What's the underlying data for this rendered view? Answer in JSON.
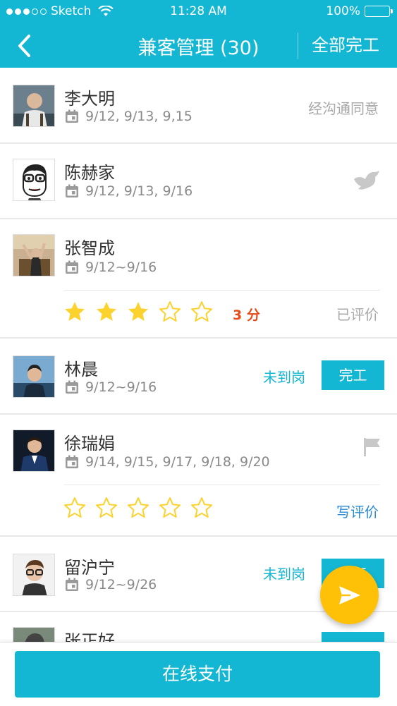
{
  "status_bar": {
    "carrier": "Sketch",
    "time": "11:28 AM",
    "battery": "100%",
    "signal_dots_filled": 3,
    "signal_dots_total": 5
  },
  "nav": {
    "back_icon": "chevron-left-icon",
    "title": "兼客管理 (30)",
    "complete_all_label": "全部完工"
  },
  "workers": [
    {
      "name": "李大明",
      "dates": "9/12, 9/13, 9,15",
      "status": "经沟通同意"
    },
    {
      "name": "陈赫家",
      "dates": "9/12, 9/13, 9/16",
      "status_icon": "bird-icon"
    },
    {
      "name": "张智成",
      "dates": "9/12~9/16",
      "rating": 3,
      "rating_max": 5,
      "score": "3 分",
      "status": "已评价"
    },
    {
      "name": "林晨",
      "dates": "9/12~9/16",
      "status": "未到岗",
      "action": "完工"
    },
    {
      "name": "徐瑞娟",
      "dates": "9/14, 9/15, 9/17, 9/18, 9/20",
      "status_icon": "flag-icon",
      "rating": 0,
      "rating_max": 5,
      "review_link": "写评价"
    },
    {
      "name": "留沪宁",
      "dates": "9/12~9/26",
      "status": "未到岗",
      "action": "完工"
    },
    {
      "name": "张正好"
    }
  ],
  "fab": {
    "icon": "send-icon"
  },
  "footer": {
    "pay_label": "在线支付"
  },
  "colors": {
    "primary": "#13b7d3",
    "star": "#fcd22f",
    "score": "#e64a19",
    "review_link": "#2b8bd6",
    "fab": "#ffc107"
  }
}
